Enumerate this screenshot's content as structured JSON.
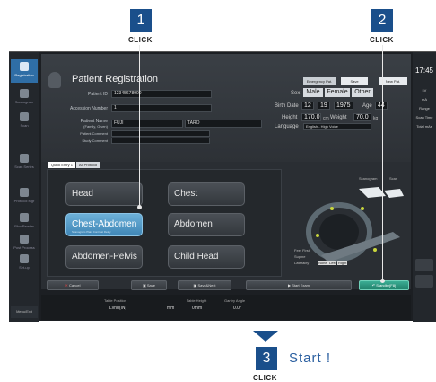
{
  "callouts": {
    "step1": {
      "number": "1",
      "caption": "CLICK"
    },
    "step2": {
      "number": "2",
      "caption": "CLICK"
    },
    "step3": {
      "number": "3",
      "caption": "CLICK",
      "text": "Start !"
    }
  },
  "sidebar": {
    "items": [
      {
        "label": "Registration",
        "active": true
      },
      {
        "label": "Scanogram"
      },
      {
        "label": "Scan"
      },
      {
        "label": "Scan Series"
      },
      {
        "label": "Protocol Mgr"
      },
      {
        "label": "Film Reader"
      },
      {
        "label": "Post Process"
      },
      {
        "label": "Set-up"
      }
    ],
    "menu_exit": "Menu/Exit"
  },
  "header": {
    "title": "Patient Registration",
    "buttons": [
      "Emergency Pat.",
      "Save",
      "New Pat."
    ]
  },
  "form": {
    "patient_id": {
      "label": "Patient ID",
      "value": "12345678900"
    },
    "accession_number": {
      "label": "Accession Number",
      "value": "1"
    },
    "patient_name": {
      "label": "Patient Name",
      "sublabel": "(Family, Given)",
      "family": "FUJI",
      "given": "TARO"
    },
    "patient_comment": {
      "label": "Patient Comment",
      "value": ""
    },
    "study_comment": {
      "label": "Study Comment",
      "value": ""
    }
  },
  "demographics": {
    "sex_label": "Sex",
    "sex_options": [
      "Male",
      "Female",
      "Other"
    ],
    "birth_date_label": "Birth Date",
    "birth_month": "12",
    "birth_day": "19",
    "birth_year": "1975",
    "age_label": "Age",
    "age_value": "44",
    "height_label": "Height",
    "height_value": "170.0",
    "height_unit": "cm",
    "weight_label": "Weight",
    "weight_value": "70.0",
    "weight_unit": "kg",
    "language_label": "Language",
    "language_value": "English - High Voice"
  },
  "tabs": [
    "Quick Entry 1",
    "All Protocol"
  ],
  "protocols": [
    {
      "label": "Head"
    },
    {
      "label": "Chest"
    },
    {
      "label": "Chest-Abdomen",
      "selected": true,
      "sub": [
        "Scanogram",
        "Plain",
        "Contrast",
        "Delay"
      ]
    },
    {
      "label": "Abdomen"
    },
    {
      "label": "Abdomen-Pelvis"
    },
    {
      "label": "Child Head"
    }
  ],
  "scan_area": {
    "scanogram_label": "Scanogram",
    "scan_label": "Scan",
    "position": [
      "Feet First",
      "Supine",
      "Laterality"
    ],
    "laterality_options": [
      "None",
      "Left",
      "Right"
    ]
  },
  "bottom_buttons": {
    "cancel": "Cancel",
    "save": "Save",
    "save_next": "Save&Next",
    "start_exam": "Start Exam",
    "standby": "Standby(F8)"
  },
  "status": {
    "table_position_label": "Table Position",
    "table_position_value": "Lvnd(IN)",
    "table_position_unit": "mm",
    "table_height_label": "Table Height",
    "table_height_value": "0mm",
    "gantry_angle_label": "Gantry Angle",
    "gantry_angle_value": "0.0°"
  },
  "right_panel": {
    "time": "17:45",
    "items": [
      "kV",
      "mA",
      "Range",
      "Scan Time",
      "Total mAs"
    ]
  }
}
